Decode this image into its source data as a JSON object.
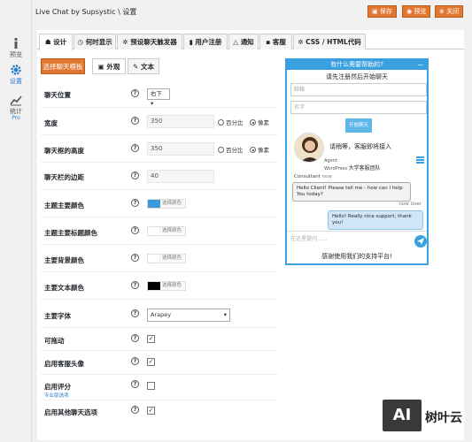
{
  "sidebar": {
    "items": [
      {
        "label": "预览",
        "icon": "info-icon"
      },
      {
        "label": "设置",
        "icon": "gear-icon"
      },
      {
        "label": "统计",
        "sub": "Pro",
        "icon": "chart-icon"
      }
    ]
  },
  "header": {
    "title": "Live Chat by Supsystic",
    "sep": "\\",
    "section": "设置",
    "buttons": {
      "save": "保存",
      "preview": "预览",
      "close": "关闭"
    }
  },
  "tabs": [
    "设计",
    "何时显示",
    "预设聊天触发器",
    "用户注册",
    "通知",
    "客服",
    "CSS / HTML代码"
  ],
  "subtabs": {
    "template_button": "选择聊天模板",
    "appearance": "外观",
    "text": "文本"
  },
  "settings": {
    "position": {
      "label": "聊天位置",
      "value": "右下"
    },
    "width": {
      "label": "宽度",
      "value": "350",
      "opt_percent": "百分比",
      "opt_pixel": "像素"
    },
    "height": {
      "label": "聊天框的高度",
      "value": "350",
      "opt_percent": "百分比",
      "opt_pixel": "像素"
    },
    "margin": {
      "label": "聊天栏的边距",
      "value": "40"
    },
    "main_color": {
      "label": "主题主要颜色",
      "btn": "选择颜色",
      "color": "#3a9ad9"
    },
    "title_color": {
      "label": "主题主要标题颜色",
      "btn": "选择颜色",
      "color": "#ffffff"
    },
    "bg_color": {
      "label": "主要背景颜色",
      "btn": "选择颜色",
      "color": "#ffffff"
    },
    "text_color": {
      "label": "主要文本颜色",
      "btn": "选择颜色",
      "color": "#000000"
    },
    "font": {
      "label": "主要字体",
      "value": "Arapey"
    },
    "draggable": {
      "label": "可拖动",
      "checked": true
    },
    "avatar": {
      "label": "启用客服头像",
      "checked": true
    },
    "rating": {
      "label": "启用评分",
      "sub": "专业版选项",
      "checked": false
    },
    "other": {
      "label": "启用其他聊天选项",
      "checked": true
    }
  },
  "help_glyph": "?",
  "check_glyph": "✓",
  "preview": {
    "header": "有什么需要帮助的?",
    "close": "−",
    "prompt": "请先注册然后开始聊天",
    "email_placeholder": "邮箱",
    "name_placeholder": "名字",
    "start": "开始聊天",
    "greeting": "请稍等，客服即将接入",
    "agent_role": "Agent",
    "agent_org": "WordPress",
    "agent_team": "大学客服团队",
    "msg_agent_name": "Consultant",
    "msg_agent_time": "now",
    "msg_agent": "Hello Client! Please tell me - how can I help You today?",
    "msg_user_meta": "now User",
    "msg_user": "Hello! Really nice support, thank you!",
    "input_placeholder": "在这里提问......",
    "footer": "感谢使用我们的支持平台!"
  },
  "watermark": {
    "logo": "AI",
    "text": "树叶云"
  }
}
